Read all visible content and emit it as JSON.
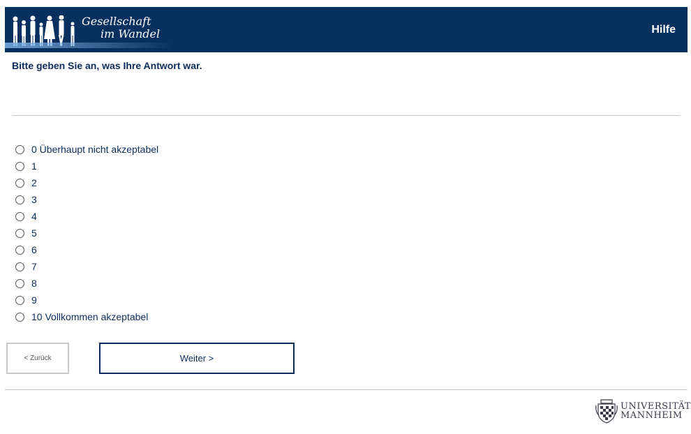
{
  "header": {
    "logo_line1": "Gesellschaft",
    "logo_line2": "im Wandel",
    "help_label": "Hilfe",
    "background_color": "#08305f"
  },
  "question": {
    "text": "Bitte geben Sie an, was Ihre Antwort war."
  },
  "options": [
    {
      "label": "0 Überhaupt nicht akzeptabel",
      "selected": false
    },
    {
      "label": "1",
      "selected": false
    },
    {
      "label": "2",
      "selected": false
    },
    {
      "label": "3",
      "selected": false
    },
    {
      "label": "4",
      "selected": false
    },
    {
      "label": "5",
      "selected": false
    },
    {
      "label": "6",
      "selected": false
    },
    {
      "label": "7",
      "selected": false
    },
    {
      "label": "8",
      "selected": false
    },
    {
      "label": "9",
      "selected": false
    },
    {
      "label": "10 Vollkommen akzeptabel",
      "selected": false
    }
  ],
  "navigation": {
    "back_label": "< Zurück",
    "next_label": "Weiter >"
  },
  "footer": {
    "university_line1": "UNIVERSITÄT",
    "university_line2": "MANNHEIM",
    "icon": "crest-icon"
  }
}
